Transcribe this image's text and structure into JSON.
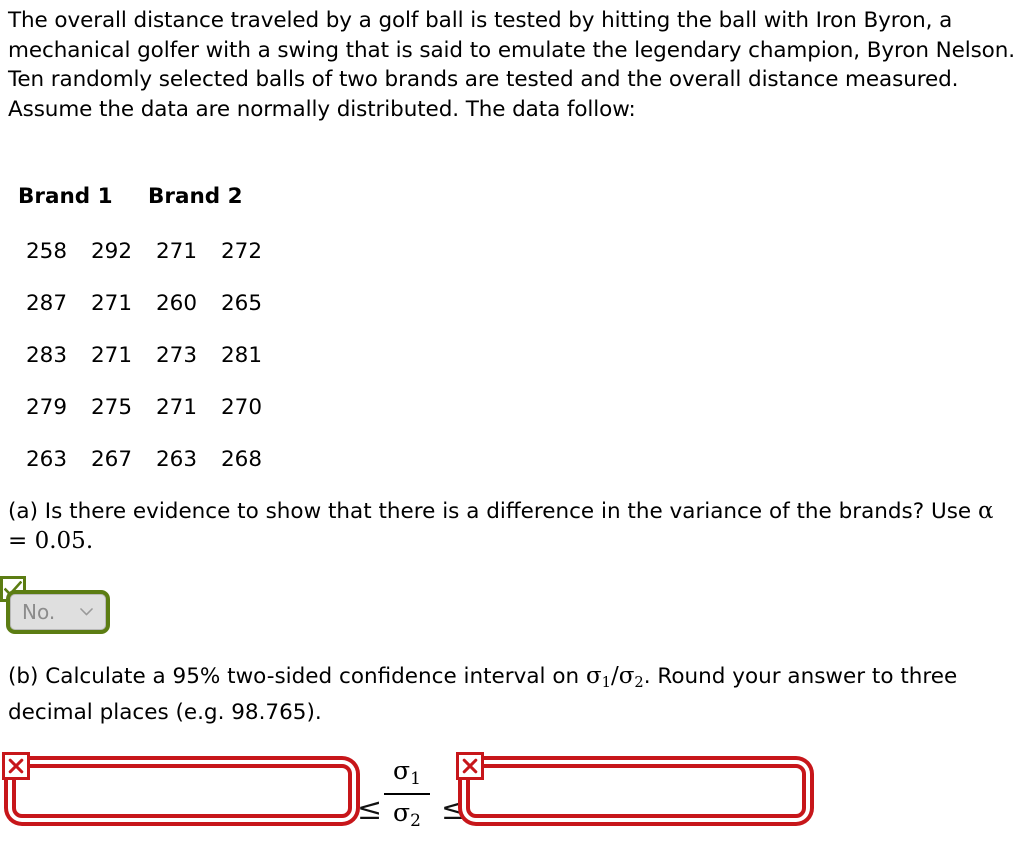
{
  "problem": {
    "statement": "The overall distance traveled by a golf ball is tested by hitting the ball with Iron Byron, a mechanical golfer with a swing that is said to emulate the legendary champion, Byron Nelson. Ten randomly selected balls of two brands are tested and the overall distance measured. Assume the data are normally distributed. The data follow:"
  },
  "table": {
    "headers": [
      "Brand 1",
      "Brand 2"
    ],
    "rows": [
      [
        "258",
        "292",
        "271",
        "272"
      ],
      [
        "287",
        "271",
        "260",
        "265"
      ],
      [
        "283",
        "271",
        "273",
        "281"
      ],
      [
        "279",
        "275",
        "271",
        "270"
      ],
      [
        "263",
        "267",
        "263",
        "268"
      ]
    ]
  },
  "part_a": {
    "text_before": "(a) Is there evidence to show that there is a difference in the variance of the brands? Use ",
    "alpha_symbol": "α",
    "equals": " = ",
    "alpha_value": "0.05",
    "period": ".",
    "answer": {
      "selected_value": "No.",
      "caret_icon": "chevron-down-icon",
      "status_icon": "check-icon",
      "status": "correct",
      "border_color": "#5c7d13",
      "fill_color": "#dfdfdf",
      "text_color": "#8c8c8c"
    }
  },
  "part_b": {
    "text_before": "(b) Calculate a 95% two-sided confidence interval on ",
    "sigma": "σ",
    "sub1": "1",
    "slash": "/",
    "sub2": "2",
    "text_after": ". Round your answer to three decimal places (e.g. 98.765)."
  },
  "answer_row": {
    "lower_bound": {
      "value": "",
      "placeholder": "",
      "status_icon": "x-icon",
      "status": "incorrect"
    },
    "upper_bound": {
      "value": "",
      "placeholder": "",
      "status_icon": "x-icon",
      "status": "incorrect"
    },
    "inequality_left": "≤",
    "inequality_right": "≤",
    "fraction_numerator_sigma": "σ",
    "fraction_numerator_sub": "1",
    "fraction_denominator_sigma": "σ",
    "fraction_denominator_sub": "2",
    "error_color": "#c7161a"
  }
}
